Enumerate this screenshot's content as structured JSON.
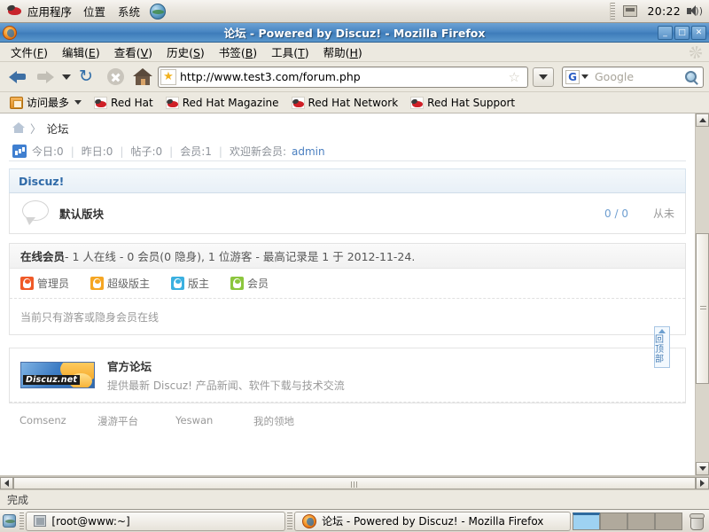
{
  "gnome_panel": {
    "menus": [
      "应用程序",
      "位置",
      "系统"
    ],
    "clock": "20:22",
    "icons": [
      "redhat-logo-icon",
      "globe-icon",
      "tray-icon",
      "speaker-icon"
    ]
  },
  "browser": {
    "title": "论坛 - Powered by Discuz! - Mozilla Firefox",
    "window_buttons": {
      "minimize": "_",
      "maximize": "□",
      "close": "✕"
    },
    "menus": [
      {
        "label": "文件",
        "accel": "F"
      },
      {
        "label": "编辑",
        "accel": "E"
      },
      {
        "label": "查看",
        "accel": "V"
      },
      {
        "label": "历史",
        "accel": "S"
      },
      {
        "label": "书签",
        "accel": "B"
      },
      {
        "label": "工具",
        "accel": "T"
      },
      {
        "label": "帮助",
        "accel": "H"
      }
    ],
    "url": "http://www.test3.com/forum.php",
    "search": {
      "engine": "G",
      "placeholder": "Google"
    },
    "bookmarks": {
      "most_visited": "访问最多",
      "items": [
        "Red Hat",
        "Red Hat Magazine",
        "Red Hat Network",
        "Red Hat Support"
      ]
    },
    "status": "完成"
  },
  "page": {
    "breadcrumb": {
      "home": "",
      "separator": "〉",
      "current": "论坛"
    },
    "stats": {
      "today_label": "今日:0",
      "yesterday_label": "昨日:0",
      "posts_label": "帖子:0",
      "members_label": "会员:1",
      "welcome_label": "欢迎新会员:",
      "welcome_user": "admin"
    },
    "section": {
      "header": "Discuz!",
      "forum": {
        "name": "默认版块",
        "threads_posts": "0 / 0",
        "last_post": "从未"
      }
    },
    "online": {
      "summary": "在线会员 - 1 人在线 - 0 会员(0 隐身), 1 位游客 - 最高记录是 1 于 2012-11-24.",
      "summary_bold": "在线会员",
      "summary_rest": " - 1 人在线 - 0 会员(0 隐身), 1 位游客 - 最高记录是 1 于 2012-11-24.",
      "legend": [
        {
          "label": "管理员",
          "color": "#ef5a28"
        },
        {
          "label": "超级版主",
          "color": "#f5a623"
        },
        {
          "label": "版主",
          "color": "#3bb0e0"
        },
        {
          "label": "会员",
          "color": "#8cc63e"
        }
      ],
      "empty_text": "当前只有游客或隐身会员在线"
    },
    "back_to_top": "回顶部",
    "promo": {
      "image_label": "Discuz.net",
      "title": "官方论坛",
      "desc": "提供最新 Discuz! 产品新闻、软件下载与技术交流"
    },
    "footer_links": [
      "Comsenz",
      "漫游平台",
      "Yeswan",
      "我的领地"
    ]
  },
  "taskbar": {
    "tasks": [
      {
        "label": "[root@www:~]",
        "icon": "terminal-icon"
      },
      {
        "label": "论坛 - Powered by Discuz! - Mozilla Firefox",
        "icon": "firefox-icon"
      }
    ],
    "workspaces": [
      "1",
      "2",
      "3",
      "4"
    ],
    "active_workspace": 0
  }
}
